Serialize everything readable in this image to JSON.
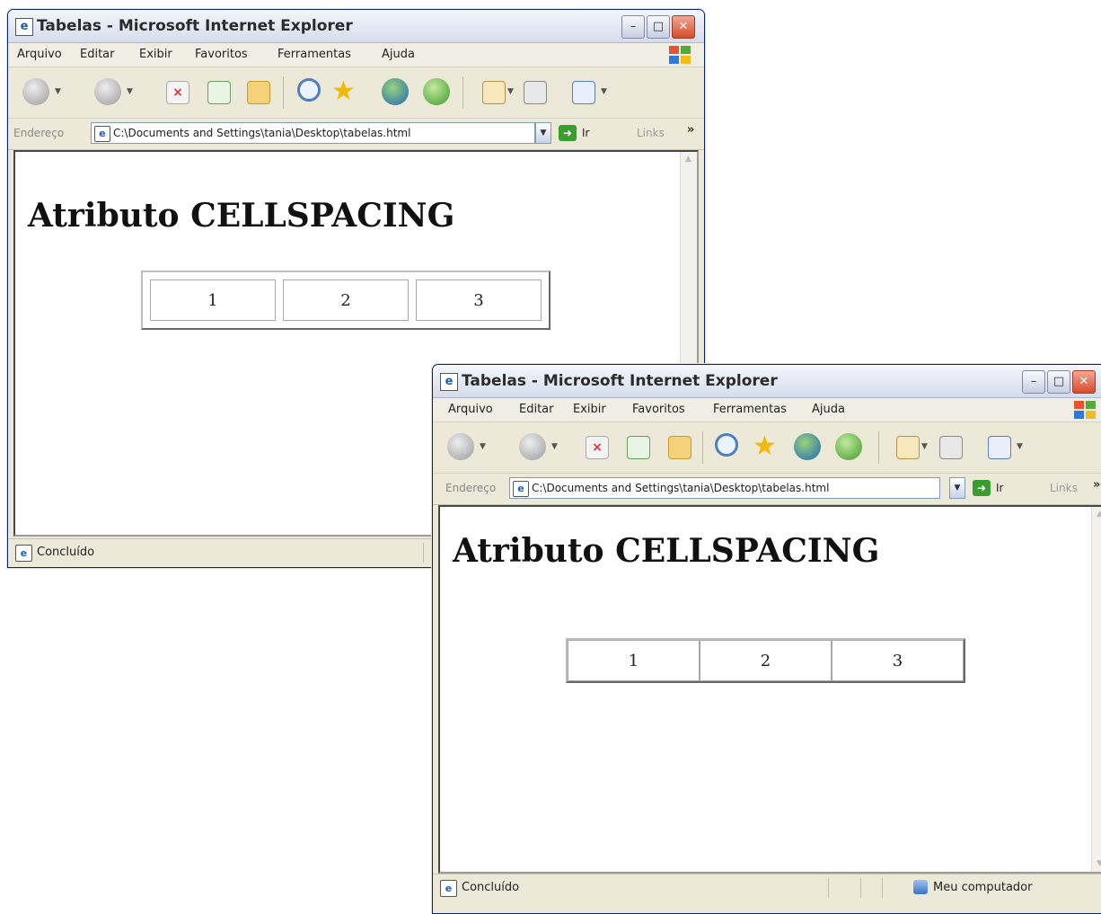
{
  "windows": [
    {
      "title": "Tabelas - Microsoft Internet Explorer",
      "menu": [
        "Arquivo",
        "Editar",
        "Exibir",
        "Favoritos",
        "Ferramentas",
        "Ajuda"
      ],
      "address_label": "Endereço",
      "address_value": "C:\\Documents and Settings\\tania\\Desktop\\tabelas.html",
      "go_label": "Ir",
      "links_label": "Links",
      "heading": "Atributo CELLSPACING",
      "table_cells": [
        "1",
        "2",
        "3"
      ],
      "status_text": "Concluído"
    },
    {
      "title": "Tabelas - Microsoft Internet Explorer",
      "menu": [
        "Arquivo",
        "Editar",
        "Exibir",
        "Favoritos",
        "Ferramentas",
        "Ajuda"
      ],
      "address_label": "Endereço",
      "address_value": "C:\\Documents and Settings\\tania\\Desktop\\tabelas.html",
      "go_label": "Ir",
      "links_label": "Links",
      "heading": "Atributo CELLSPACING",
      "table_cells": [
        "1",
        "2",
        "3"
      ],
      "status_text": "Concluído",
      "zone_text": "Meu computador"
    }
  ],
  "colors": {
    "title_bar": "#dfe4ef",
    "close_button": "#d64a2b",
    "chrome": "#ece9d8",
    "go_button": "#3a9e2f"
  }
}
